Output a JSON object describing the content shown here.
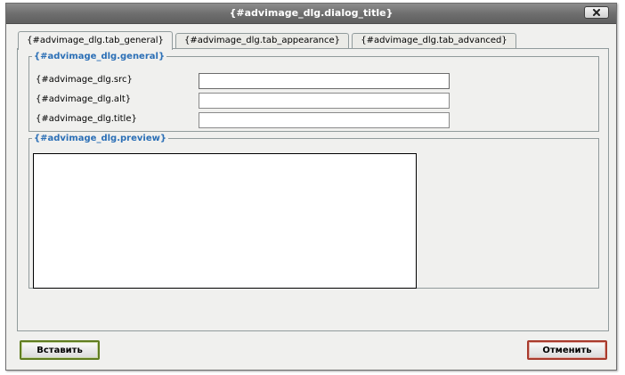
{
  "dialog": {
    "title": "{#advimage_dlg.dialog_title}"
  },
  "tabs": [
    {
      "label": "{#advimage_dlg.tab_general}",
      "active": true
    },
    {
      "label": "{#advimage_dlg.tab_appearance}",
      "active": false
    },
    {
      "label": "{#advimage_dlg.tab_advanced}",
      "active": false
    }
  ],
  "general": {
    "legend": "{#advimage_dlg.general}",
    "fields": [
      {
        "label": "{#advimage_dlg.src}",
        "value": ""
      },
      {
        "label": "{#advimage_dlg.alt}",
        "value": ""
      },
      {
        "label": "{#advimage_dlg.title}",
        "value": ""
      }
    ]
  },
  "preview": {
    "legend": "{#advimage_dlg.preview}"
  },
  "buttons": {
    "insert": "Вставить",
    "cancel": "Отменить"
  },
  "colors": {
    "legend": "#2b6fb6",
    "insert_border": "#607d20",
    "cancel_border": "#a83a2c",
    "titlebar": "#6f6f6f"
  }
}
